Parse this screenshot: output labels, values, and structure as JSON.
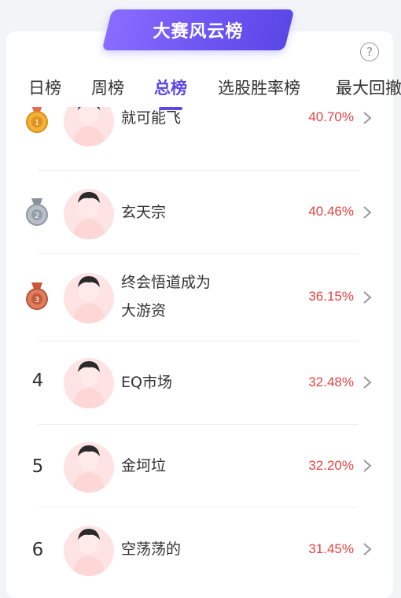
{
  "banner": {
    "title": "大赛风云榜"
  },
  "help": {
    "symbol": "?"
  },
  "tabs": [
    {
      "label": "日榜",
      "active": false
    },
    {
      "label": "周榜",
      "active": false
    },
    {
      "label": "总榜",
      "active": true
    },
    {
      "label": "选股胜率榜",
      "active": false
    },
    {
      "label": "最大回撤",
      "active": false
    }
  ],
  "leaderboard": [
    {
      "rank": "1",
      "medal": "gold-medal-icon",
      "name": "就可能飞",
      "percent": "40.70%"
    },
    {
      "rank": "2",
      "medal": "silver-medal-icon",
      "name": "玄天宗",
      "percent": "40.46%"
    },
    {
      "rank": "3",
      "medal": "bronze-medal-icon",
      "name_line1": "终会悟道成为",
      "name_line2": "大游资",
      "percent": "36.15%"
    },
    {
      "rank": "4",
      "name": "EQ市场",
      "percent": "32.48%"
    },
    {
      "rank": "5",
      "name": "金坷垃",
      "percent": "32.20%"
    },
    {
      "rank": "6",
      "name": "空荡荡的",
      "percent": "31.45%"
    }
  ],
  "colors": {
    "accent": "#5b48e6",
    "percent": "#e24343",
    "avatar_bg": "#fde3e3",
    "gold": "#e8a523",
    "silver": "#9aa3ad",
    "bronze": "#d06a4c"
  }
}
